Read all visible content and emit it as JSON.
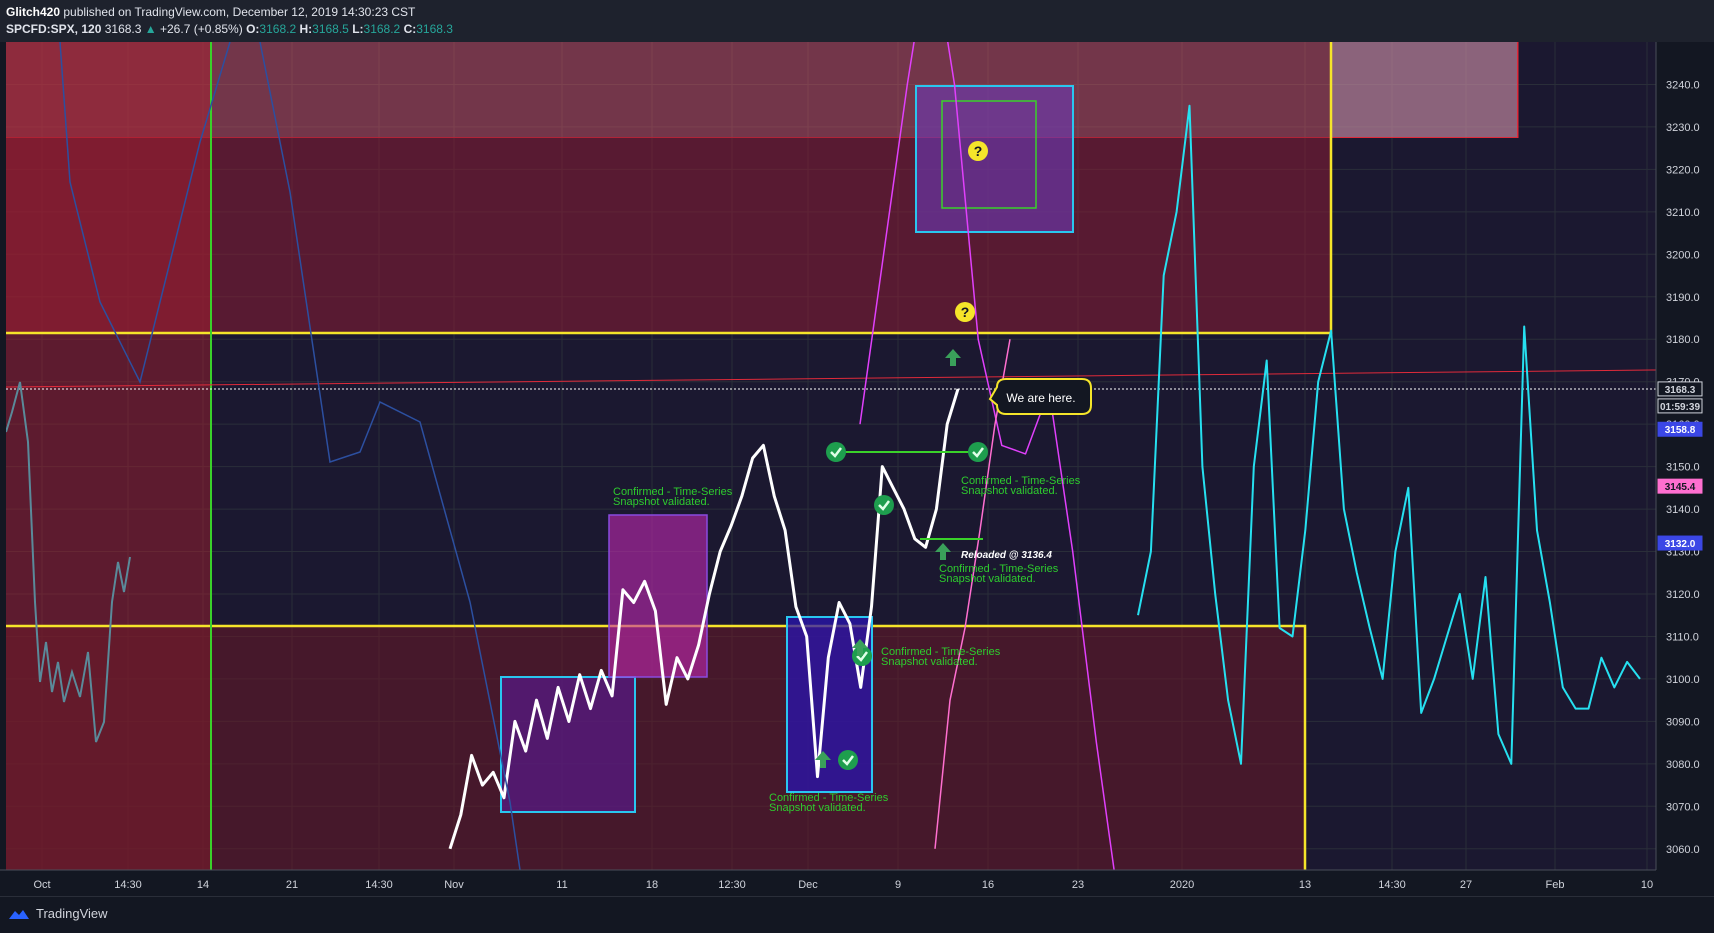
{
  "header": {
    "author": "Glitch420",
    "published_text": "published on TradingView.com, December 12, 2019 14:30:23 CST",
    "symbol": "SPCFD:SPX, 120",
    "last": "3168.3",
    "change": "+26.7 (+0.85%)",
    "o_label": "O:",
    "o": "3168.2",
    "h_label": "H:",
    "h": "3168.5",
    "l_label": "L:",
    "l": "3168.2",
    "c_label": "C:",
    "c": "3168.3"
  },
  "footer": {
    "brand": "TradingView",
    "logo_icon": "tradingview-logo-icon"
  },
  "colors": {
    "background": "#131722",
    "price_line": "#ffffff",
    "cyan_line": "#26e0f0",
    "magenta_line": "#e040fb",
    "pink_line": "#ff6fd0",
    "navy_line": "#2c4fa0",
    "yellow_box": "#f5e52a",
    "red_zone": "#e02a3a",
    "green_vline": "#3ad12a",
    "annotation_text": "#2ecc2e",
    "check_icon": "#1e9e4e"
  },
  "chart_data": {
    "type": "line",
    "symbol": "SPCFD:SPX",
    "ylim": [
      3055,
      3250
    ],
    "y_ticks": [
      3060,
      3070,
      3080,
      3090,
      3100,
      3110,
      3120,
      3130,
      3140,
      3150,
      3160,
      3170,
      3180,
      3190,
      3200,
      3210,
      3220,
      3230,
      3240
    ],
    "x_ticks": [
      "Oct",
      "14:30",
      "14",
      "21",
      "14:30",
      "Nov",
      "11",
      "18",
      "12:30",
      "Dec",
      "9",
      "16",
      "23",
      "2020",
      "13",
      "14:30",
      "27",
      "Feb",
      "10"
    ],
    "price_labels": [
      {
        "value": "3168.3",
        "style": "last"
      },
      {
        "value": "01:59:39",
        "style": "countdown"
      },
      {
        "value": "3158.8",
        "style": "blue"
      },
      {
        "value": "3145.4",
        "style": "pink"
      },
      {
        "value": "3132.0",
        "style": "blue"
      }
    ],
    "series": [
      {
        "values": [
          3060,
          3068,
          3082,
          3075,
          3078,
          3072,
          3090,
          3083,
          3095,
          3086,
          3098,
          3090,
          3101,
          3093,
          3102,
          3096,
          3121,
          3118,
          3123,
          3116,
          3094,
          3105,
          3100,
          3108,
          3120,
          3130,
          3136,
          3143,
          3152,
          3155,
          3143,
          3135,
          3117,
          3110,
          3077,
          3105,
          3118,
          3113,
          3098,
          3117,
          3150,
          3145,
          3140,
          3133,
          3131,
          3140,
          3160,
          3168.3
        ]
      },
      {
        "values": [
          3115,
          3130,
          3195,
          3210,
          3235,
          3150,
          3120,
          3095,
          3080,
          3150,
          3175,
          3112,
          3110,
          3135,
          3170,
          3182,
          3140,
          3125,
          3112,
          3100,
          3130,
          3145,
          3092,
          3100,
          3110,
          3120,
          3100,
          3124,
          3087,
          3080,
          3183,
          3135,
          3118,
          3098,
          3093,
          3093,
          3105,
          3098,
          3104,
          3100
        ]
      },
      {
        "values": [
          3160,
          3200,
          3240,
          3275,
          3240,
          3180,
          3155,
          3153,
          3168,
          3130,
          3085,
          3045
        ]
      },
      {
        "values": [
          3060,
          3095,
          3112,
          3135,
          3160,
          3180
        ]
      }
    ],
    "annotations": [
      {
        "text": "We are here.",
        "kind": "callout"
      },
      {
        "text": "Reloaded @ 3136.4",
        "kind": "label"
      },
      {
        "text": "Confirmed - Time-Series",
        "sub": "Snapshot validated.",
        "kind": "confirm"
      },
      {
        "text": "Confirmed - Time-Series",
        "sub": "Snapshot validated.",
        "kind": "confirm"
      },
      {
        "text": "Confirmed - Time-Series",
        "sub": "Snapshot validated.",
        "kind": "confirm"
      },
      {
        "text": "Confirmed - Time-Series",
        "sub": "Snapshot validated.",
        "kind": "confirm"
      },
      {
        "text": "Confirmed - Time-Series",
        "sub": "Snapshot validated.",
        "kind": "confirm"
      }
    ],
    "icons": [
      "check-icon",
      "question-icon",
      "arrow-up-icon"
    ],
    "grid": true
  }
}
